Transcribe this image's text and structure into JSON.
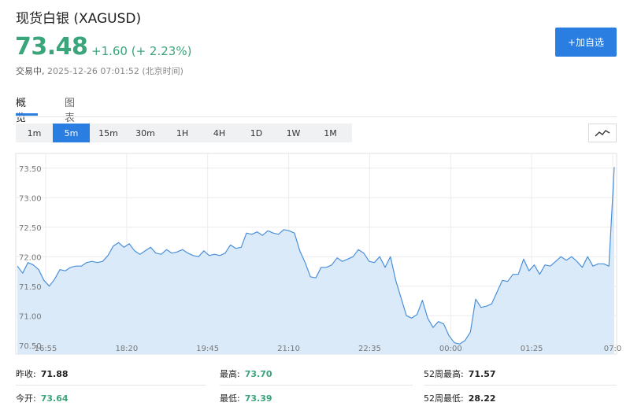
{
  "header": {
    "title": "现货白银 (XAGUSD)",
    "price": "73.48",
    "change": "+1.60 (+ 2.23%)",
    "status": "交易中,",
    "timestamp": "2025-12-26 07:01:52 (北京时间)",
    "add_button": "+加自选"
  },
  "tabs": [
    {
      "label": "概览",
      "active": true
    },
    {
      "label": "图表",
      "active": false
    }
  ],
  "ranges": [
    {
      "label": "1m",
      "active": false
    },
    {
      "label": "5m",
      "active": true
    },
    {
      "label": "15m",
      "active": false
    },
    {
      "label": "30m",
      "active": false
    },
    {
      "label": "1H",
      "active": false
    },
    {
      "label": "4H",
      "active": false
    },
    {
      "label": "1D",
      "active": false
    },
    {
      "label": "1W",
      "active": false
    },
    {
      "label": "1M",
      "active": false
    }
  ],
  "chart_type_icon": "line-chart-icon",
  "colors": {
    "accent": "#2a7de1",
    "up": "#3aa57a",
    "line": "#4a90d9",
    "area": "#dbeaf9"
  },
  "chart_data": {
    "type": "area",
    "ylim": [
      70.35,
      73.75
    ],
    "y_ticks": [
      "70.50",
      "71.00",
      "71.50",
      "72.00",
      "72.50",
      "73.00",
      "73.50"
    ],
    "x_ticks": [
      "16:55",
      "18:20",
      "19:45",
      "21:10",
      "22:35",
      "00:00",
      "01:25",
      "07:0"
    ],
    "grid": true,
    "series": [
      {
        "values": [
          71.84,
          71.72,
          71.9,
          71.86,
          71.78,
          71.6,
          71.5,
          71.62,
          71.78,
          71.76,
          71.82,
          71.84,
          71.84,
          71.9,
          71.92,
          71.9,
          71.92,
          72.02,
          72.18,
          72.24,
          72.16,
          72.22,
          72.1,
          72.04,
          72.1,
          72.16,
          72.06,
          72.04,
          72.12,
          72.06,
          72.08,
          72.12,
          72.06,
          72.02,
          72.0,
          72.1,
          72.02,
          72.04,
          72.02,
          72.06,
          72.2,
          72.14,
          72.16,
          72.4,
          72.38,
          72.42,
          72.36,
          72.44,
          72.4,
          72.38,
          72.46,
          72.44,
          72.4,
          72.1,
          71.9,
          71.66,
          71.64,
          71.82,
          71.82,
          71.86,
          71.98,
          71.92,
          71.96,
          72.0,
          72.12,
          72.06,
          71.92,
          71.9,
          72.0,
          71.82,
          72.0,
          71.6,
          71.3,
          71.0,
          70.96,
          71.02,
          71.26,
          70.96,
          70.8,
          70.9,
          70.86,
          70.66,
          70.54,
          70.52,
          70.58,
          70.72,
          71.28,
          71.14,
          71.16,
          71.2,
          71.4,
          71.6,
          71.58,
          71.7,
          71.7,
          71.96,
          71.76,
          71.86,
          71.7,
          71.86,
          71.84,
          71.92,
          72.0,
          71.94,
          72.0,
          71.92,
          71.82,
          72.0,
          71.84,
          71.88,
          71.88,
          71.84,
          73.52
        ]
      }
    ]
  },
  "stats": {
    "col1": [
      {
        "label": "昨收:",
        "value": "71.88",
        "color": "black"
      },
      {
        "label": "今开:",
        "value": "73.64",
        "color": "green"
      }
    ],
    "col2": [
      {
        "label": "最高:",
        "value": "73.70",
        "color": "green"
      },
      {
        "label": "最低:",
        "value": "73.39",
        "color": "green"
      }
    ],
    "col3": [
      {
        "label": "52周最高:",
        "value": "71.57",
        "color": "black"
      },
      {
        "label": "52周最低:",
        "value": "28.22",
        "color": "black"
      }
    ]
  }
}
